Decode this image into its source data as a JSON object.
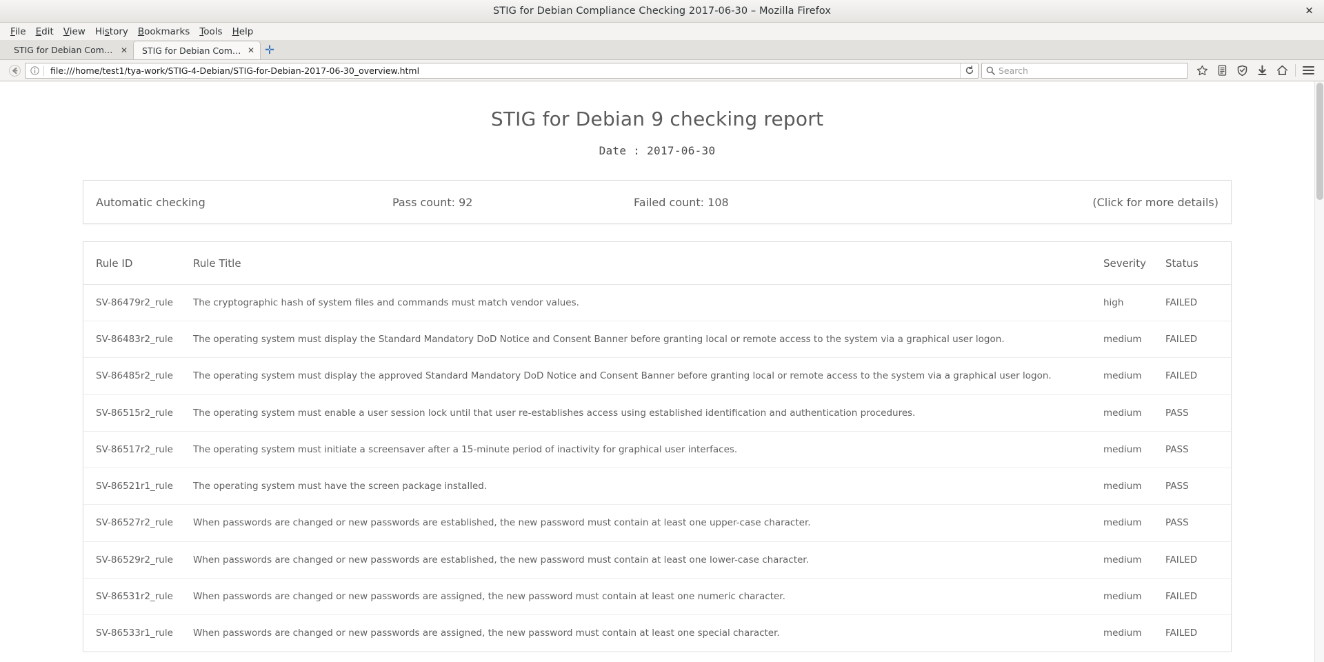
{
  "window": {
    "title": "STIG for Debian Compliance Checking 2017-06-30 – Mozilla Firefox",
    "close_label": "✕"
  },
  "menubar": [
    {
      "name": "file",
      "pre": "",
      "key": "F",
      "post": "ile"
    },
    {
      "name": "edit",
      "pre": "",
      "key": "E",
      "post": "dit"
    },
    {
      "name": "view",
      "pre": "",
      "key": "V",
      "post": "iew"
    },
    {
      "name": "history",
      "pre": "Hi",
      "key": "s",
      "post": "tory"
    },
    {
      "name": "bookmarks",
      "pre": "",
      "key": "B",
      "post": "ookmarks"
    },
    {
      "name": "tools",
      "pre": "",
      "key": "T",
      "post": "ools"
    },
    {
      "name": "help",
      "pre": "",
      "key": "H",
      "post": "elp"
    }
  ],
  "tabs": [
    {
      "label": "STIG for Debian Complia...",
      "active": false,
      "close": "✕"
    },
    {
      "label": "STIG for Debian Complia...",
      "active": true,
      "close": "✕"
    }
  ],
  "newtab_label": "✛",
  "urlbar": {
    "url": "file:///home/test1/tya-work/STIG-4-Debian/STIG-for-Debian-2017-06-30_overview.html",
    "reload_label": "⟳",
    "back_label": "←"
  },
  "search": {
    "placeholder": "Search"
  },
  "page": {
    "title": "STIG for Debian 9 checking report",
    "date_line": "Date :  2017-06-30",
    "summary": {
      "label": "Automatic checking",
      "pass_count": "Pass count: 92",
      "failed_count": "Failed count: 108",
      "details_hint": "(Click for more details)"
    },
    "table": {
      "headers": {
        "rule_id": "Rule ID",
        "rule_title": "Rule Title",
        "severity": "Severity",
        "status": "Status"
      },
      "rows": [
        {
          "rule_id": "SV-86479r2_rule",
          "rule_title": "The cryptographic hash of system files and commands must match vendor values.",
          "severity": "high",
          "status": "FAILED"
        },
        {
          "rule_id": "SV-86483r2_rule",
          "rule_title": "The operating system must display the Standard Mandatory DoD Notice and Consent Banner before granting local or remote access to the system via a graphical user logon.",
          "severity": "medium",
          "status": "FAILED"
        },
        {
          "rule_id": "SV-86485r2_rule",
          "rule_title": "The operating system must display the approved Standard Mandatory DoD Notice and Consent Banner before granting local or remote access to the system via a graphical user logon.",
          "severity": "medium",
          "status": "FAILED"
        },
        {
          "rule_id": "SV-86515r2_rule",
          "rule_title": "The operating system must enable a user session lock until that user re-establishes access using established identification and authentication procedures.",
          "severity": "medium",
          "status": "PASS"
        },
        {
          "rule_id": "SV-86517r2_rule",
          "rule_title": "The operating system must initiate a screensaver after a 15-minute period of inactivity for graphical user interfaces.",
          "severity": "medium",
          "status": "PASS"
        },
        {
          "rule_id": "SV-86521r1_rule",
          "rule_title": "The operating system must have the screen package installed.",
          "severity": "medium",
          "status": "PASS"
        },
        {
          "rule_id": "SV-86527r2_rule",
          "rule_title": "When passwords are changed or new passwords are established, the new password must contain at least one upper-case character.",
          "severity": "medium",
          "status": "PASS"
        },
        {
          "rule_id": "SV-86529r2_rule",
          "rule_title": "When passwords are changed or new passwords are established, the new password must contain at least one lower-case character.",
          "severity": "medium",
          "status": "FAILED"
        },
        {
          "rule_id": "SV-86531r2_rule",
          "rule_title": "When passwords are changed or new passwords are assigned, the new password must contain at least one numeric character.",
          "severity": "medium",
          "status": "FAILED"
        },
        {
          "rule_id": "SV-86533r1_rule",
          "rule_title": "When passwords are changed or new passwords are assigned, the new password must contain at least one special character.",
          "severity": "medium",
          "status": "FAILED"
        }
      ]
    }
  },
  "colors": {
    "failed": "#f79fae",
    "text": "#616161"
  }
}
